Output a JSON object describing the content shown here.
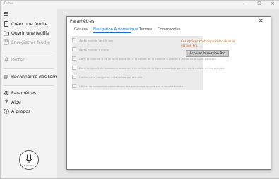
{
  "app": {
    "title": "Dictée"
  },
  "window_controls": {
    "minimize": "—",
    "maximize": "☐",
    "close": "✕"
  },
  "sidebar": {
    "items": [
      {
        "label": "Créer une feuille"
      },
      {
        "label": "Ouvrir une feuille"
      },
      {
        "label": "Enregistrer feuille"
      },
      {
        "label": "Dicter"
      },
      {
        "label": "Reconnaître des termes"
      },
      {
        "label": "Paramètres"
      },
      {
        "label": "Aide"
      },
      {
        "label": "À propos"
      }
    ],
    "mic_button_label": "Démarrer"
  },
  "dialog": {
    "title": "Paramètres",
    "close": "✕",
    "tabs": [
      {
        "label": "Général"
      },
      {
        "label": "Navigation Automatique"
      },
      {
        "label": "Termes"
      },
      {
        "label": "Commandes"
      }
    ],
    "active_tab": "Navigation Automatique",
    "options": [
      {
        "label": "Après humide vers le bas",
        "checked": false
      },
      {
        "label": "Après humide à droite",
        "checked": false
      },
      {
        "label": "Dans la colonne A de la ligne suivante, à la cellule de la colonne suivante à droite de la ligne suivante",
        "checked": false
      },
      {
        "label": "Dans la ligne 1 de la colonne suivante, à la cellule de la ligne suivante à gauche de la cellule active est vide",
        "checked": false
      },
      {
        "label": "Continuer la navigation si la cellule est remplie",
        "checked": false
      },
      {
        "label": "Utiliser la navigation automatique lorsque vous appuyez sur la touche Entrée",
        "checked": false
      }
    ],
    "pro_notice": "Ces options sont disponibles dans la version Pro.",
    "pro_button": "Acheter la version Pro"
  },
  "colors": {
    "accent": "#1f6fc8",
    "pro_notice": "#e0590f"
  }
}
